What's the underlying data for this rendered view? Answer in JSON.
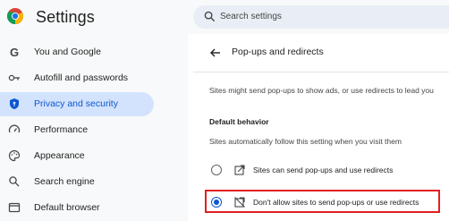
{
  "header": {
    "title": "Settings",
    "search_placeholder": "Search settings"
  },
  "sidebar": {
    "items": [
      {
        "label": "You and Google",
        "icon": "google-g-icon",
        "active": false
      },
      {
        "label": "Autofill and passwords",
        "icon": "key-icon",
        "active": false
      },
      {
        "label": "Privacy and security",
        "icon": "shield-icon",
        "active": true
      },
      {
        "label": "Performance",
        "icon": "speedometer-icon",
        "active": false
      },
      {
        "label": "Appearance",
        "icon": "palette-icon",
        "active": false
      },
      {
        "label": "Search engine",
        "icon": "search-icon",
        "active": false
      },
      {
        "label": "Default browser",
        "icon": "browser-window-icon",
        "active": false
      }
    ]
  },
  "main": {
    "page_title": "Pop-ups and redirects",
    "description": "Sites might send pop-ups to show ads, or use redirects to lead you",
    "section_heading": "Default behavior",
    "section_subtitle": "Sites automatically follow this setting when you visit them",
    "options": [
      {
        "label": "Sites can send pop-ups and use redirects",
        "icon": "popup-open-icon",
        "selected": false
      },
      {
        "label": "Don't allow sites to send pop-ups or use redirects",
        "icon": "popup-blocked-icon",
        "selected": true
      }
    ]
  },
  "colors": {
    "accent": "#0b57d0",
    "active_bg": "#d3e3fd",
    "highlight": "#e02020"
  }
}
